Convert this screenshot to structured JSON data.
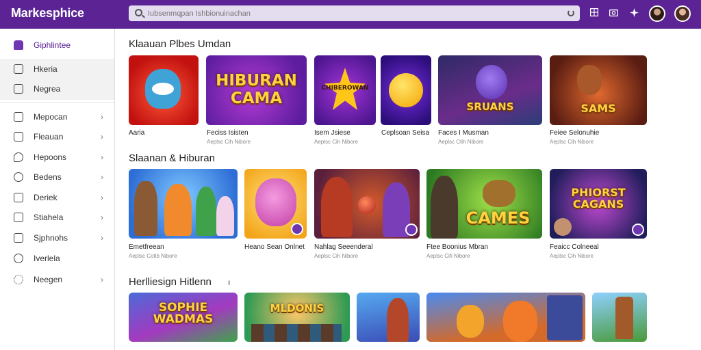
{
  "app": {
    "brand": "Markesphice"
  },
  "search": {
    "placeholder": "Iubsenmqpan Ishbionuinachan"
  },
  "sidebar": {
    "items": [
      {
        "label": "Giphlintee",
        "icon": "home-icon",
        "chevron": false
      },
      {
        "label": "Hkeria",
        "icon": "edit-icon",
        "chevron": false
      },
      {
        "label": "Negrea",
        "icon": "grid-icon",
        "chevron": false
      },
      {
        "label": "Mepocan",
        "icon": "calendar-icon",
        "chevron": true
      },
      {
        "label": "Fleauan",
        "icon": "puzzle-icon",
        "chevron": true
      },
      {
        "label": "Hepoons",
        "icon": "bubble-icon",
        "chevron": true
      },
      {
        "label": "Bedens",
        "icon": "target-icon",
        "chevron": true
      },
      {
        "label": "Deriek",
        "icon": "check-icon",
        "chevron": true
      },
      {
        "label": "Stiahela",
        "icon": "layers-icon",
        "chevron": true
      },
      {
        "label": "Sjphnohs",
        "icon": "box-icon",
        "chevron": true
      },
      {
        "label": "Iverlela",
        "icon": "globe-icon",
        "chevron": false
      },
      {
        "label": "Neegen",
        "icon": "settings-icon",
        "chevron": true
      }
    ],
    "chevron_glyph": "›"
  },
  "sections": [
    {
      "title": "Klaauan Plbes Umdan",
      "tiles": [
        {
          "title": "Aaria",
          "sub": ""
        },
        {
          "title": "Feciss Isisten",
          "sub": "Aeplsc Cih Nibore"
        },
        {
          "title": "Isem Jsiese",
          "sub": "Aeplsc Cih Nibore"
        },
        {
          "title": "Ceplsoan Seisa",
          "sub": ""
        },
        {
          "title": "Faces I Musman",
          "sub": "Aeplsc Ctih Nibore"
        },
        {
          "title": "Feiee Selonuhie",
          "sub": "Aeplsc Cih Nibore"
        }
      ],
      "art": [
        "",
        "HIBURAN|CAMA",
        "CHIBEROWAN",
        "",
        "SRUANS",
        "SAMS"
      ]
    },
    {
      "title": "Slaanan & Hiburan",
      "tiles": [
        {
          "title": "Emetfreean",
          "sub": "Aeplsc Cotib Nibore"
        },
        {
          "title": "Heano Sean Onlnet",
          "sub": ""
        },
        {
          "title": "Nahlag Seeenderal",
          "sub": "Aeplsc Cih Nibore"
        },
        {
          "title": "Ftee Boonius Mbran",
          "sub": "Aeplsc Cifi Nibore"
        },
        {
          "title": "Feaicc Colneeal",
          "sub": "Aeplsc Cih Nibore"
        }
      ],
      "art": [
        "",
        "",
        "",
        "CAMES",
        "PHIORST|CAGANS"
      ]
    },
    {
      "title": "Herlliesign Hitlenn",
      "tiles": [],
      "art": [
        "SOPHIE|WADMAS",
        "MLDONIS",
        "",
        "",
        ""
      ]
    }
  ],
  "colors": {
    "brand": "#5b2394",
    "accent": "#6e36b0",
    "search_bg": "#e4ddef"
  }
}
